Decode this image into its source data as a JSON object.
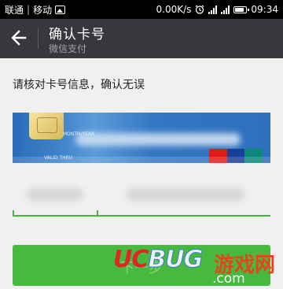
{
  "status_bar": {
    "carrier_1": "联通",
    "separator": "|",
    "carrier_2": "移动",
    "image_icon": "image-icon",
    "network_speed": "0.00K/s",
    "alarm_icon": "alarm-icon",
    "signal_icon": "signal-icon",
    "battery_icon": "battery-icon",
    "time": "09:34"
  },
  "header": {
    "title": "确认卡号",
    "subtitle": "微信支付",
    "back_icon": "back-arrow-icon",
    "background": "#37383c"
  },
  "main": {
    "instruction": "请核对卡号信息，确认无误",
    "card": {
      "chip_icon": "card-chip-icon",
      "small_text_left": "VALID THRU",
      "small_text_mid": "MONTH/YEAR",
      "brand_icon": "unionpay-logo-icon"
    },
    "fields": {
      "accent": "#47b341"
    },
    "confirm_button": {
      "label": "下一步",
      "color": "#48b93f"
    }
  },
  "watermark": {
    "logo_uc": "UC",
    "logo_bug": "BUG",
    "site_name": "游戏网",
    "domain": ".com"
  }
}
